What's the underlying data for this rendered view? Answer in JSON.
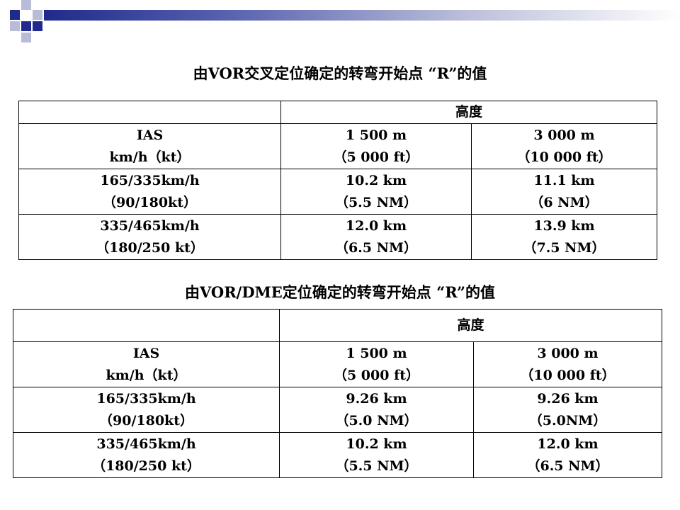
{
  "tables": [
    {
      "title": "由VOR交叉定位确定的转弯开始点 “R”的值",
      "header": {
        "empty": "",
        "altitude": "高度"
      },
      "columns": [
        {
          "line1": "IAS",
          "line2": "km/h（kt）"
        },
        {
          "line1": "1 500 m",
          "line2": "（5 000 ft）"
        },
        {
          "line1": "3 000 m",
          "line2": "（10 000 ft）"
        }
      ],
      "rows": [
        {
          "ias": {
            "line1": "165/335km/h",
            "line2": "（90/180kt）"
          },
          "alt1500": {
            "line1": "10.2 km",
            "line2": "（5.5 NM）"
          },
          "alt3000": {
            "line1": "11.1 km",
            "line2": "（6 NM）"
          }
        },
        {
          "ias": {
            "line1": "335/465km/h",
            "line2": "（180/250 kt）"
          },
          "alt1500": {
            "line1": "12.0 km",
            "line2": "（6.5 NM）"
          },
          "alt3000": {
            "line1": "13.9 km",
            "line2": "（7.5 NM）"
          }
        }
      ]
    },
    {
      "title": "由VOR/DME定位确定的转弯开始点 “R”的值",
      "header": {
        "empty": "",
        "altitude": "高度"
      },
      "columns": [
        {
          "line1": "IAS",
          "line2": "km/h（kt）"
        },
        {
          "line1": "1 500 m",
          "line2": "（5 000 ft）"
        },
        {
          "line1": "3 000 m",
          "line2": "（10 000 ft）"
        }
      ],
      "rows": [
        {
          "ias": {
            "line1": "165/335km/h",
            "line2": "（90/180kt）"
          },
          "alt1500": {
            "line1": "9.26 km",
            "line2": "（5.0 NM）"
          },
          "alt3000": {
            "line1": "9.26 km",
            "line2": "（5.0NM）"
          }
        },
        {
          "ias": {
            "line1": "335/465km/h",
            "line2": "（180/250 kt）"
          },
          "alt1500": {
            "line1": "10.2 km",
            "line2": "（5.5 NM）"
          },
          "alt3000": {
            "line1": "12.0 km",
            "line2": "（6.5 NM）"
          }
        }
      ]
    }
  ]
}
